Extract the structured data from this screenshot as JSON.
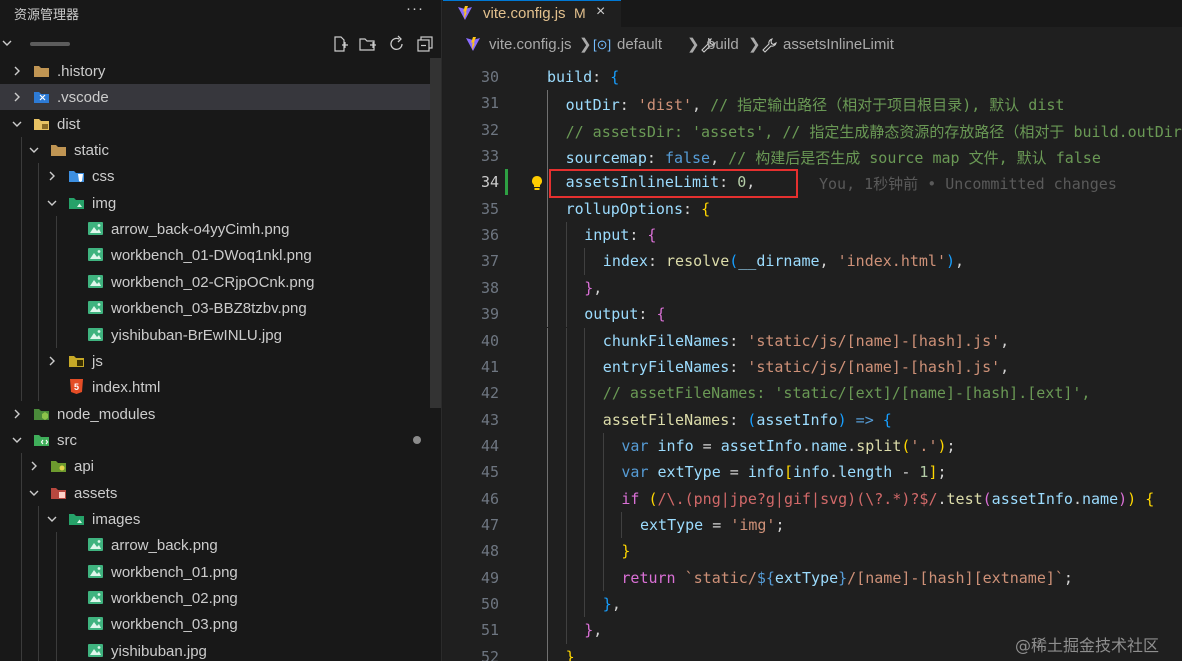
{
  "sidebar": {
    "title": "资源管理器",
    "more_label": "···",
    "actions": [
      "new-file",
      "new-folder",
      "refresh",
      "collapse-all"
    ],
    "tree": [
      {
        "label": ".history",
        "depth": 0,
        "kind": "folder",
        "expanded": false,
        "icon": "folder-icon"
      },
      {
        "label": ".vscode",
        "depth": 0,
        "kind": "folder",
        "expanded": false,
        "icon": "vscode-folder-icon",
        "selected": true
      },
      {
        "label": "dist",
        "depth": 0,
        "kind": "folder",
        "expanded": true,
        "icon": "dist-folder-icon"
      },
      {
        "label": "static",
        "depth": 1,
        "kind": "folder",
        "expanded": true,
        "icon": "folder-icon"
      },
      {
        "label": "css",
        "depth": 2,
        "kind": "folder",
        "expanded": false,
        "icon": "css-folder-icon"
      },
      {
        "label": "img",
        "depth": 2,
        "kind": "folder",
        "expanded": true,
        "icon": "image-folder-icon"
      },
      {
        "label": "arrow_back-o4yyCimh.png",
        "depth": 3,
        "kind": "file",
        "icon": "image-file-icon"
      },
      {
        "label": "workbench_01-DWoq1nkl.png",
        "depth": 3,
        "kind": "file",
        "icon": "image-file-icon"
      },
      {
        "label": "workbench_02-CRjpOCnk.png",
        "depth": 3,
        "kind": "file",
        "icon": "image-file-icon"
      },
      {
        "label": "workbench_03-BBZ8tzbv.png",
        "depth": 3,
        "kind": "file",
        "icon": "image-file-icon"
      },
      {
        "label": "yishibuban-BrEwINLU.jpg",
        "depth": 3,
        "kind": "file",
        "icon": "image-file-icon"
      },
      {
        "label": "js",
        "depth": 2,
        "kind": "folder",
        "expanded": false,
        "icon": "js-folder-icon"
      },
      {
        "label": "index.html",
        "depth": 2,
        "kind": "file",
        "icon": "html-file-icon"
      },
      {
        "label": "node_modules",
        "depth": 0,
        "kind": "folder",
        "expanded": false,
        "icon": "node-folder-icon"
      },
      {
        "label": "src",
        "depth": 0,
        "kind": "folder",
        "expanded": true,
        "icon": "src-folder-icon",
        "modified": true
      },
      {
        "label": "api",
        "depth": 1,
        "kind": "folder",
        "expanded": false,
        "icon": "api-folder-icon"
      },
      {
        "label": "assets",
        "depth": 1,
        "kind": "folder",
        "expanded": true,
        "icon": "assets-folder-icon"
      },
      {
        "label": "images",
        "depth": 2,
        "kind": "folder",
        "expanded": true,
        "icon": "image-folder-icon"
      },
      {
        "label": "arrow_back.png",
        "depth": 3,
        "kind": "file",
        "icon": "image-file-icon"
      },
      {
        "label": "workbench_01.png",
        "depth": 3,
        "kind": "file",
        "icon": "image-file-icon"
      },
      {
        "label": "workbench_02.png",
        "depth": 3,
        "kind": "file",
        "icon": "image-file-icon"
      },
      {
        "label": "workbench_03.png",
        "depth": 3,
        "kind": "file",
        "icon": "image-file-icon"
      },
      {
        "label": "yishibuban.jpg",
        "depth": 3,
        "kind": "file",
        "icon": "image-file-icon"
      }
    ]
  },
  "editor": {
    "tab": {
      "name": "vite.config.js",
      "badge": "M",
      "close": "×"
    },
    "breadcrumbs": [
      "vite.config.js",
      "default",
      "build",
      "assetsInlineLimit"
    ],
    "active_line": 34,
    "blame": "You, 1秒钟前 • Uncommitted changes",
    "lines": [
      {
        "n": 30,
        "indent": 0,
        "tokens": [
          [
            "build",
            "k"
          ],
          [
            ": ",
            "o"
          ],
          [
            "{",
            "p3"
          ]
        ]
      },
      {
        "n": 31,
        "indent": 1,
        "tokens": [
          [
            "outDir",
            "k"
          ],
          [
            ": ",
            "o"
          ],
          [
            "'dist'",
            "s"
          ],
          [
            ", ",
            "o"
          ],
          [
            "// 指定输出路径（相对于项目根目录), 默认 dist",
            "c"
          ]
        ]
      },
      {
        "n": 32,
        "indent": 1,
        "tokens": [
          [
            "// assetsDir: 'assets', // 指定生成静态资源的存放路径（相对于 build.outDir",
            "c"
          ]
        ]
      },
      {
        "n": 33,
        "indent": 1,
        "tokens": [
          [
            "sourcemap",
            "k"
          ],
          [
            ": ",
            "o"
          ],
          [
            "false",
            "b"
          ],
          [
            ", ",
            "o"
          ],
          [
            "// 构建后是否生成 source map 文件, 默认 false",
            "c"
          ]
        ]
      },
      {
        "n": 34,
        "indent": 1,
        "tokens": [
          [
            "assetsInlineLimit",
            "k"
          ],
          [
            ": ",
            "o"
          ],
          [
            "0",
            "n"
          ],
          [
            ",",
            "o"
          ]
        ]
      },
      {
        "n": 35,
        "indent": 1,
        "tokens": [
          [
            "rollupOptions",
            "k"
          ],
          [
            ": ",
            "o"
          ],
          [
            "{",
            "p"
          ]
        ]
      },
      {
        "n": 36,
        "indent": 2,
        "tokens": [
          [
            "input",
            "k"
          ],
          [
            ": ",
            "o"
          ],
          [
            "{",
            "p2"
          ]
        ]
      },
      {
        "n": 37,
        "indent": 3,
        "tokens": [
          [
            "index",
            "k"
          ],
          [
            ": ",
            "o"
          ],
          [
            "resolve",
            "f"
          ],
          [
            "(",
            "p3"
          ],
          [
            "__dirname",
            "k"
          ],
          [
            ", ",
            "o"
          ],
          [
            "'index.html'",
            "s"
          ],
          [
            ")",
            "p3"
          ],
          [
            ",",
            "o"
          ]
        ]
      },
      {
        "n": 38,
        "indent": 2,
        "tokens": [
          [
            "}",
            "p2"
          ],
          [
            ",",
            "o"
          ]
        ]
      },
      {
        "n": 39,
        "indent": 2,
        "tokens": [
          [
            "output",
            "k"
          ],
          [
            ": ",
            "o"
          ],
          [
            "{",
            "p2"
          ]
        ]
      },
      {
        "n": 40,
        "indent": 3,
        "tokens": [
          [
            "chunkFileNames",
            "k"
          ],
          [
            ": ",
            "o"
          ],
          [
            "'static/js/[name]-[hash].js'",
            "s"
          ],
          [
            ",",
            "o"
          ]
        ]
      },
      {
        "n": 41,
        "indent": 3,
        "tokens": [
          [
            "entryFileNames",
            "k"
          ],
          [
            ": ",
            "o"
          ],
          [
            "'static/js/[name]-[hash].js'",
            "s"
          ],
          [
            ",",
            "o"
          ]
        ]
      },
      {
        "n": 42,
        "indent": 3,
        "tokens": [
          [
            "// assetFileNames: 'static/[ext]/[name]-[hash].[ext]',",
            "c"
          ]
        ]
      },
      {
        "n": 43,
        "indent": 3,
        "tokens": [
          [
            "assetFileNames",
            "f"
          ],
          [
            ": ",
            "o"
          ],
          [
            "(",
            "p3"
          ],
          [
            "assetInfo",
            "k"
          ],
          [
            ")",
            "p3"
          ],
          [
            " => ",
            "b"
          ],
          [
            "{",
            "p3"
          ]
        ]
      },
      {
        "n": 44,
        "indent": 4,
        "tokens": [
          [
            "var ",
            "b"
          ],
          [
            "info",
            "k"
          ],
          [
            " = ",
            "o"
          ],
          [
            "assetInfo",
            "k"
          ],
          [
            ".",
            "o"
          ],
          [
            "name",
            "k"
          ],
          [
            ".",
            "o"
          ],
          [
            "split",
            "f"
          ],
          [
            "(",
            "p"
          ],
          [
            "'.'",
            "s"
          ],
          [
            ")",
            "p"
          ],
          [
            ";",
            "o"
          ]
        ]
      },
      {
        "n": 45,
        "indent": 4,
        "tokens": [
          [
            "var ",
            "b"
          ],
          [
            "extType",
            "k"
          ],
          [
            " = ",
            "o"
          ],
          [
            "info",
            "k"
          ],
          [
            "[",
            "p"
          ],
          [
            "info",
            "k"
          ],
          [
            ".",
            "o"
          ],
          [
            "length",
            "k"
          ],
          [
            " - ",
            "o"
          ],
          [
            "1",
            "n"
          ],
          [
            "]",
            "p"
          ],
          [
            ";",
            "o"
          ]
        ]
      },
      {
        "n": 46,
        "indent": 4,
        "tokens": [
          [
            "if ",
            "p2"
          ],
          [
            "(",
            "p"
          ],
          [
            "/\\.(png|jpe?g|gif|svg)(\\?.*)?$/",
            "r"
          ],
          [
            ".",
            "o"
          ],
          [
            "test",
            "f"
          ],
          [
            "(",
            "p2"
          ],
          [
            "assetInfo",
            "k"
          ],
          [
            ".",
            "o"
          ],
          [
            "name",
            "k"
          ],
          [
            ")",
            "p2"
          ],
          [
            ")",
            "p"
          ],
          [
            " {",
            "p"
          ]
        ]
      },
      {
        "n": 47,
        "indent": 5,
        "tokens": [
          [
            "extType",
            "k"
          ],
          [
            " = ",
            "o"
          ],
          [
            "'img'",
            "s"
          ],
          [
            ";",
            "o"
          ]
        ]
      },
      {
        "n": 48,
        "indent": 4,
        "tokens": [
          [
            "}",
            "p"
          ]
        ]
      },
      {
        "n": 49,
        "indent": 4,
        "tokens": [
          [
            "return ",
            "p2"
          ],
          [
            "`static/",
            "s"
          ],
          [
            "${",
            "b"
          ],
          [
            "extType",
            "k"
          ],
          [
            "}",
            "b"
          ],
          [
            "/[name]-[hash][extname]`",
            "s"
          ],
          [
            ";",
            "o"
          ]
        ]
      },
      {
        "n": 50,
        "indent": 3,
        "tokens": [
          [
            "}",
            "p3"
          ],
          [
            ",",
            "o"
          ]
        ]
      },
      {
        "n": 51,
        "indent": 2,
        "tokens": [
          [
            "}",
            "p2"
          ],
          [
            ",",
            "o"
          ]
        ]
      },
      {
        "n": 52,
        "indent": 1,
        "tokens": [
          [
            "}",
            "p"
          ]
        ]
      }
    ]
  },
  "watermark": "@稀土掘金技术社区",
  "colors": {
    "accent": "#0078d4",
    "modified": "#e2c08d",
    "highlight_box": "#e5302f",
    "git_added": "#2ea043"
  }
}
